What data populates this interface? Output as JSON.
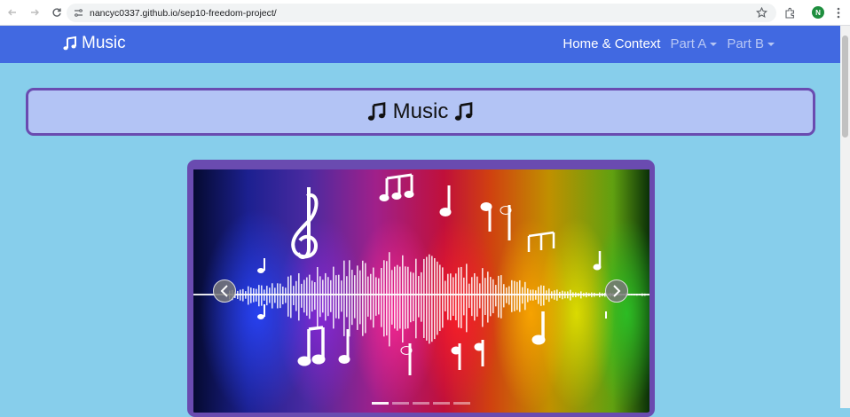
{
  "browser": {
    "url": "nancyc0337.github.io/sep10-freedom-project/",
    "profile_initial": "N"
  },
  "navbar": {
    "brand": "Music",
    "links": [
      {
        "label": "Home & Context",
        "active": true,
        "dropdown": false
      },
      {
        "label": "Part A",
        "active": false,
        "dropdown": true
      },
      {
        "label": "Part B",
        "active": false,
        "dropdown": true
      }
    ],
    "color": "#4169e1"
  },
  "page": {
    "title": "Music",
    "background": "#87ceeb",
    "accent": "#6a4bb0",
    "title_box_color": "#b3c4f5"
  },
  "carousel": {
    "slide_count": 5,
    "active_index": 0,
    "prev_icon": "chevron-left-icon",
    "next_icon": "chevron-right-icon"
  }
}
